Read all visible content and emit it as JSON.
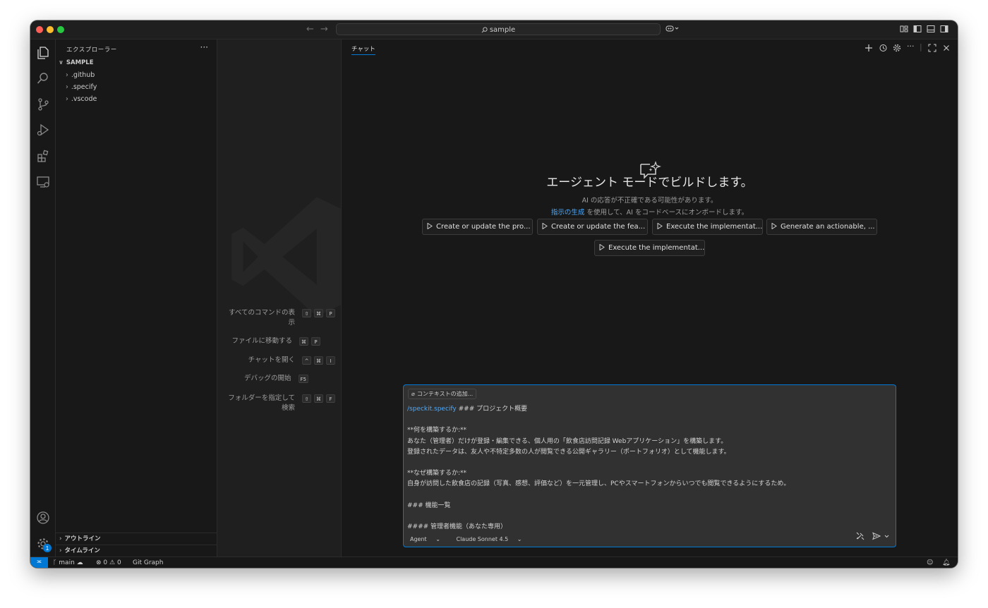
{
  "titlebar": {
    "search_text": "sample"
  },
  "sidebar": {
    "title": "エクスプローラー",
    "more": "···",
    "folder": "SAMPLE",
    "items": [
      {
        "label": ".github"
      },
      {
        "label": ".specify"
      },
      {
        "label": ".vscode"
      }
    ],
    "outline": "アウトライン",
    "timeline": "タイムライン"
  },
  "editor": {
    "shortcuts": [
      {
        "label": "すべてのコマンドの表示",
        "keys": [
          "⇧",
          "⌘",
          "P"
        ]
      },
      {
        "label": "ファイルに移動する",
        "keys": [
          "⌘",
          "P"
        ]
      },
      {
        "label": "チャットを開く",
        "keys": [
          "^",
          "⌘",
          "I"
        ]
      },
      {
        "label": "デバッグの開始",
        "keys": [
          "F5"
        ]
      },
      {
        "label": "フォルダーを指定して検索",
        "keys": [
          "⇧",
          "⌘",
          "F"
        ]
      }
    ]
  },
  "chat": {
    "tab": "チャット",
    "title": "エージェント モードでビルドします。",
    "disclaimer": "AI の応答が不正確である可能性があります。",
    "instruction_link": "指示の生成",
    "instruction_rest": " を使用して、AI をコードベースにオンボードします。",
    "suggestions": [
      "Create or update the pro...",
      "Create or update the fea...",
      "Execute the implementat...",
      "Generate an actionable, ...",
      "Execute the implementat..."
    ],
    "input": {
      "context_button": "コンテキストの追加...",
      "command": "/speckit.specify",
      "first_line_rest": " ### プロジェクト概要",
      "lines": [
        "",
        "**何を構築するか:**",
        "あなた（管理者）だけが登録・編集できる、個人用の「飲食店訪問記録 Webアプリケーション」を構築します。",
        "登録されたデータは、友人や不特定多数の人が閲覧できる公開ギャラリー（ポートフォリオ）として機能します。",
        "",
        "**なぜ構築するか:**",
        "自身が訪問した飲食店の記録（写真、感想、評価など）を一元管理し、PCやスマートフォンからいつでも閲覧できるようにするため。",
        "",
        "### 機能一覧",
        "",
        "#### 管理者機能（あなた専用）"
      ],
      "mode": "Agent",
      "model": "Claude Sonnet 4.5"
    }
  },
  "statusbar": {
    "branch": "main",
    "errors": "0",
    "warnings": "0",
    "git_graph": "Git Graph"
  },
  "activity": {
    "settings_badge": "1"
  },
  "colors": {
    "accent": "#0078d4",
    "link": "#4daafc"
  }
}
